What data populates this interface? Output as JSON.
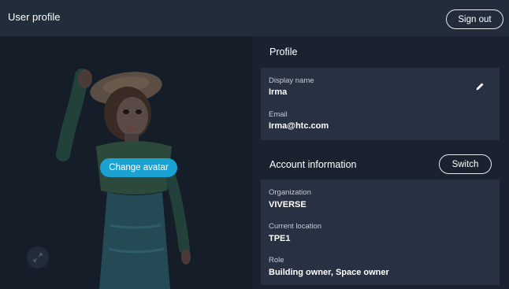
{
  "header": {
    "title": "User profile",
    "sign_out_label": "Sign out"
  },
  "avatar_panel": {
    "change_avatar_label": "Change avatar",
    "expand_icon": "expand-arrows-icon"
  },
  "profile": {
    "section_title": "Profile",
    "display_name_label": "Display name",
    "display_name_value": "Irma",
    "email_label": "Email",
    "email_value": "Irma@htc.com",
    "edit_icon": "pencil-icon"
  },
  "account": {
    "section_title": "Account information",
    "switch_label": "Switch",
    "organization_label": "Organization",
    "organization_value": "VIVERSE",
    "location_label": "Current location",
    "location_value": "TPE1",
    "role_label": "Role",
    "role_value": "Building owner, Space owner"
  },
  "colors": {
    "background": "#1a2230",
    "header": "#232c3a",
    "card": "#283141",
    "accent": "#1aa2d2"
  }
}
